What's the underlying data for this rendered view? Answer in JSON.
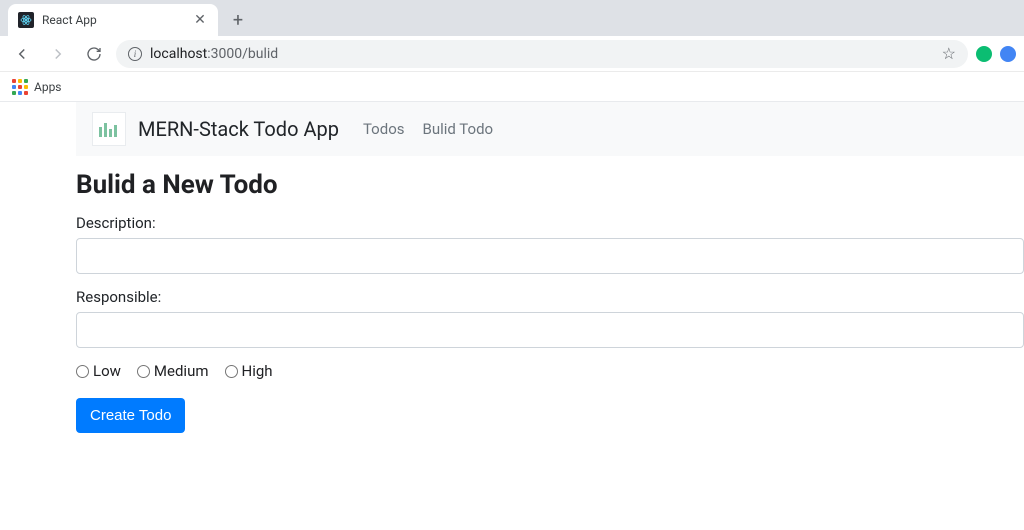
{
  "browser": {
    "tab_title": "React App",
    "url_host": "localhost",
    "url_port_path": ":3000/bulid",
    "bookmarks_apps_label": "Apps"
  },
  "navbar": {
    "brand": "MERN-Stack Todo App",
    "links": [
      {
        "label": "Todos"
      },
      {
        "label": "Bulid Todo"
      }
    ]
  },
  "page": {
    "heading": "Bulid a New Todo",
    "description_label": "Description:",
    "description_value": "",
    "responsible_label": "Responsible:",
    "responsible_value": "",
    "priorities": [
      {
        "label": "Low"
      },
      {
        "label": "Medium"
      },
      {
        "label": "High"
      }
    ],
    "submit_label": "Create Todo"
  }
}
